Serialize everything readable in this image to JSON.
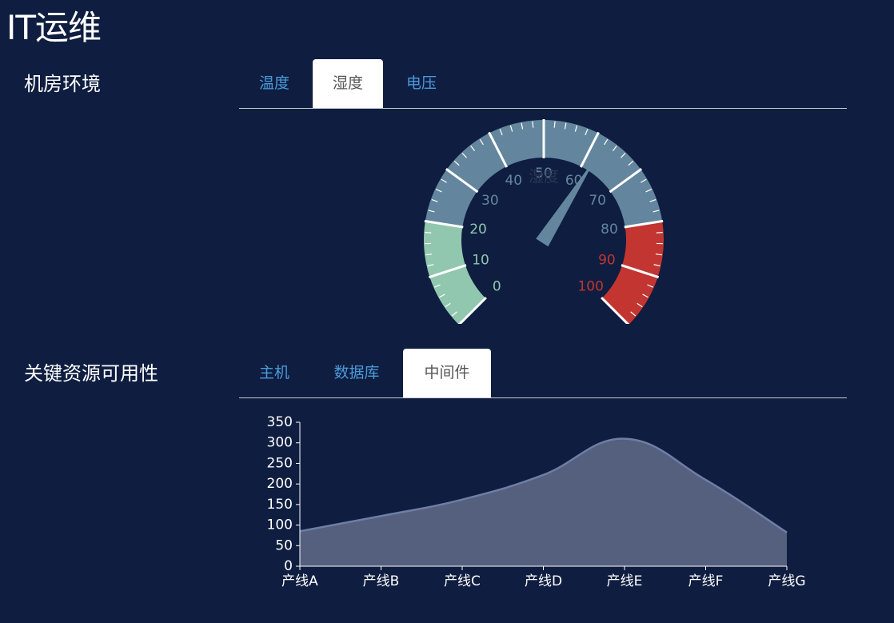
{
  "page": {
    "title": "IT运维"
  },
  "sections": {
    "environment": {
      "label": "机房环境",
      "tabs": [
        {
          "label": "温度",
          "active": false
        },
        {
          "label": "湿度",
          "active": true
        },
        {
          "label": "电压",
          "active": false
        }
      ]
    },
    "availability": {
      "label": "关键资源可用性",
      "tabs": [
        {
          "label": "主机",
          "active": false
        },
        {
          "label": "数据库",
          "active": false
        },
        {
          "label": "中间件",
          "active": true
        }
      ]
    }
  },
  "colors": {
    "background": "#0f1d40",
    "tab_text": "#4a9ad9",
    "gauge_low": "#91c7ae",
    "gauge_mid": "#63869e",
    "gauge_high": "#c23531",
    "area_fill": "#555f7e",
    "area_line": "#6f7ea6"
  },
  "chart_data": [
    {
      "type": "gauge",
      "name": "湿度",
      "value": 62,
      "min": 0,
      "max": 100,
      "tick_labels": [
        "0",
        "10",
        "20",
        "30",
        "40",
        "50",
        "60",
        "70",
        "80",
        "90",
        "100"
      ],
      "bands": [
        {
          "to": 20,
          "color": "#91c7ae"
        },
        {
          "to": 80,
          "color": "#63869e"
        },
        {
          "to": 100,
          "color": "#c23531"
        }
      ]
    },
    {
      "type": "area",
      "categories": [
        "产线A",
        "产线B",
        "产线C",
        "产线D",
        "产线E",
        "产线F",
        "产线G"
      ],
      "values": [
        85,
        122,
        162,
        222,
        310,
        210,
        82
      ],
      "ylim": [
        0,
        350
      ],
      "yticks": [
        "0",
        "50",
        "100",
        "150",
        "200",
        "250",
        "300",
        "350"
      ],
      "smooth": true,
      "grid": false
    }
  ]
}
